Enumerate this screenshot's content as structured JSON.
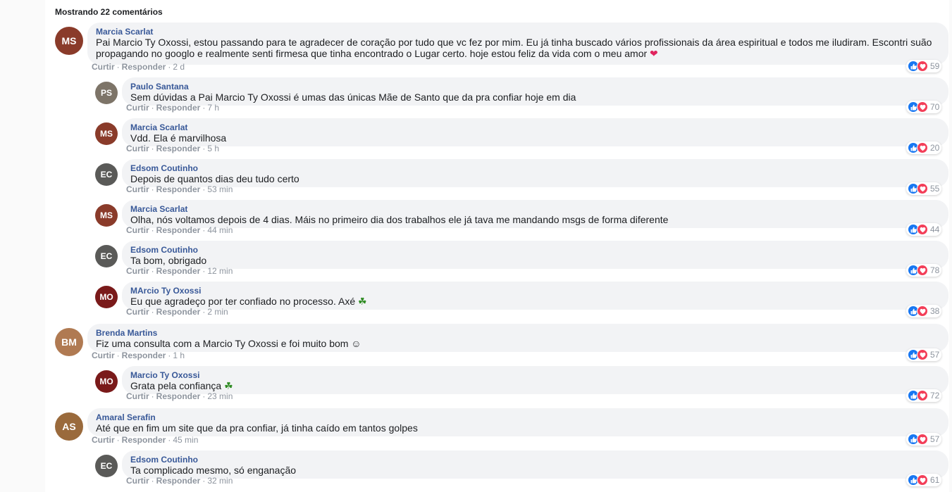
{
  "header": {
    "count_label": "Mostrando 22 comentários"
  },
  "colors": {
    "author": "#385898",
    "bubble": "#f2f3f5",
    "like": "#1877f2",
    "love": "#f33e58",
    "meta": "#8d949e"
  },
  "icons": {
    "like": "thumbs-up-icon",
    "love": "heart-icon",
    "inline_heart": "red-heart-emoji",
    "inline_clover": "shamrock-emoji"
  },
  "actions": {
    "like": "Curtir",
    "reply": "Responder"
  },
  "comments": [
    {
      "author": "Marcia Scarlat",
      "initials": "MS",
      "avatar_color": "#8a3b2a",
      "text": "Pai Marcio Ty Oxossi, estou passando para te agradecer de coração por tudo que vc fez por mim. Eu já tinha buscado vários profissionais da área espiritual e todos me iludiram. Escontri suão propagando no googlo e realmente senti firmesa que tinha encontrado o Lugar certo. hoje estou feliz da vida com o meu amor",
      "emoji": "❤",
      "time": "2 d",
      "reactions": "59"
    },
    {
      "author": "Paulo Santana",
      "initials": "PS",
      "avatar_color": "#7d7468",
      "text": "Sem dúvidas a Pai Marcio Ty Oxossi é umas das únicas Mãe de Santo que da pra confiar hoje em dia",
      "emoji": "",
      "time": "7 h",
      "reactions": "70"
    },
    {
      "author": "Marcia Scarlat",
      "initials": "MS",
      "avatar_color": "#8a3b2a",
      "text": "Vdd. Ela é marvilhosa",
      "emoji": "",
      "time": "5 h",
      "reactions": "20"
    },
    {
      "author": "Edsom Coutinho",
      "initials": "EC",
      "avatar_color": "#5a5a58",
      "text": "Depois de quantos dias deu tudo certo",
      "emoji": "",
      "time": "53 min",
      "reactions": "55"
    },
    {
      "author": "Marcia Scarlat",
      "initials": "MS",
      "avatar_color": "#8a3b2a",
      "text": "Olha, nós voltamos depois de 4 dias. Máis no primeiro dia dos trabalhos ele já tava me mandando msgs de forma diferente",
      "emoji": "",
      "time": "44 min",
      "reactions": "44"
    },
    {
      "author": "Edsom Coutinho",
      "initials": "EC",
      "avatar_color": "#5a5a58",
      "text": "Ta bom, obrigado",
      "emoji": "",
      "time": "12 min",
      "reactions": "78"
    },
    {
      "author": "MArcio Ty Oxossi",
      "initials": "MO",
      "avatar_color": "#7a1a1a",
      "text": "Eu que agradeço por ter confiado no processo. Axé",
      "emoji": "☘",
      "time": "2 min",
      "reactions": "38"
    },
    {
      "author": "Brenda Martins",
      "initials": "BM",
      "avatar_color": "#b07a52",
      "text": "Fiz uma consulta com a Marcio Ty Oxossi e foi muito bom ☺",
      "emoji": "",
      "time": "1 h",
      "reactions": "57"
    },
    {
      "author": "Marcio Ty Oxossi",
      "initials": "MO",
      "avatar_color": "#7a1a1a",
      "text": "Grata pela confiança",
      "emoji": "☘",
      "time": "23 min",
      "reactions": "72"
    },
    {
      "author": "Amaral Serafin",
      "initials": "AS",
      "avatar_color": "#9a6a3c",
      "text": "Até que en fim um site que da pra confiar, já tinha caído em tantos golpes",
      "emoji": "",
      "time": "45 min",
      "reactions": "57"
    },
    {
      "author": "Edsom Coutinho",
      "initials": "EC",
      "avatar_color": "#5a5a58",
      "text": "Ta complicado mesmo, só enganação",
      "emoji": "",
      "time": "32 min",
      "reactions": "61"
    }
  ]
}
